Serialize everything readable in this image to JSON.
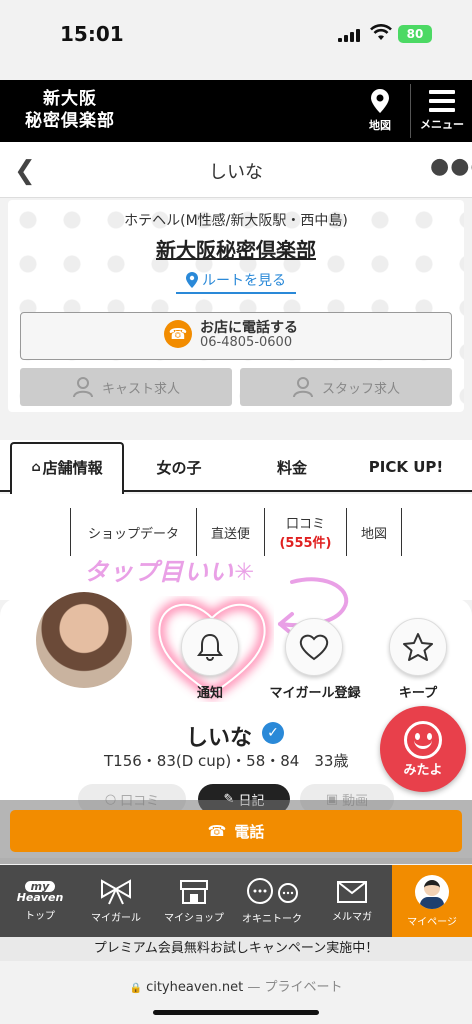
{
  "status": {
    "time": "15:01",
    "battery": "80"
  },
  "header": {
    "logo_line1": "新大阪",
    "logo_line2": "秘密倶楽部",
    "map_label": "地図",
    "menu_label": "メニュー"
  },
  "title_bar": {
    "title": "しいな"
  },
  "shop": {
    "category": "ホテヘル(M性感/新大阪駅・西中島)",
    "name": "新大阪秘密倶楽部",
    "route_label": "ルートを見る",
    "call_label": "お店に電話する",
    "phone": "06-4805-0600",
    "cast_recruit": "キャスト求人",
    "staff_recruit": "スタッフ求人"
  },
  "tabs": [
    "店舗情報",
    "女の子",
    "料金",
    "PICK UP!"
  ],
  "subnav": {
    "shop_data": "ショップデータ",
    "direct": "直送便",
    "reviews": "口コミ",
    "review_count": "(555件)",
    "map": "地図"
  },
  "profile": {
    "tap_note": "タップ目いい✳︎",
    "notify_label": "通知",
    "mygirl_label": "マイガール登録",
    "keep_label": "キープ",
    "name": "しいな",
    "stats": "T156・83(D cup)・58・84　33歳",
    "mitayo": "みたよ"
  },
  "mini_tabs": {
    "reviews": "口コミ",
    "diary": "日記",
    "video": "動画"
  },
  "call_bar": {
    "label": "電話"
  },
  "bottom_nav": {
    "logo_my": "my",
    "logo_heaven": "Heaven",
    "items": [
      "トップ",
      "マイガール",
      "マイショップ",
      "オキニトーク",
      "メルマガ",
      "マイページ"
    ]
  },
  "promo": "プレミアム会員無料お試しキャンペーン実施中！",
  "url": {
    "host": "cityheaven.net",
    "mode": "— プライベート"
  },
  "colors": {
    "accent": "#f28c00",
    "link": "#2a89d8",
    "alert": "#e8404b"
  }
}
